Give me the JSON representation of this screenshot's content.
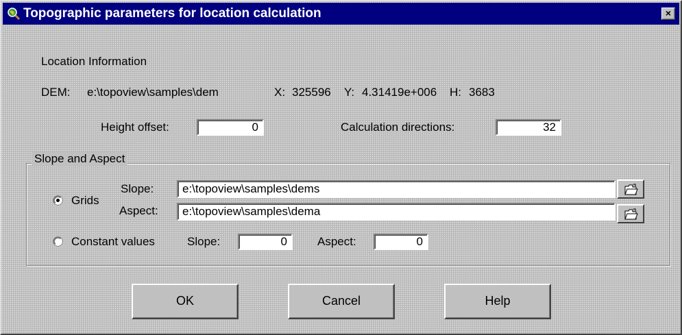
{
  "window": {
    "title": "Topographic parameters for location calculation",
    "close_label": "×"
  },
  "location": {
    "section_label": "Location Information",
    "dem_label": "DEM:",
    "dem_value": "e:\\topoview\\samples\\dem",
    "x_label": "X:",
    "x_value": "325596",
    "y_label": "Y:",
    "y_value": "4.31419e+006",
    "h_label": "H:",
    "h_value": "3683"
  },
  "height_offset": {
    "label": "Height offset:",
    "value": "0"
  },
  "calc_directions": {
    "label": "Calculation directions:",
    "value": "32"
  },
  "slope_aspect": {
    "group_label": "Slope and Aspect",
    "grids": {
      "label": "Grids",
      "selected": true,
      "slope_label": "Slope:",
      "slope_value": "e:\\topoview\\samples\\dems",
      "aspect_label": "Aspect:",
      "aspect_value": "e:\\topoview\\samples\\dema"
    },
    "constant": {
      "label": "Constant values",
      "selected": false,
      "slope_label": "Slope:",
      "slope_value": "0",
      "aspect_label": "Aspect:",
      "aspect_value": "0"
    }
  },
  "buttons": {
    "ok": "OK",
    "cancel": "Cancel",
    "help": "Help"
  },
  "icons": {
    "title": "magnifier-globe-icon",
    "browse": "open-folder-icon"
  }
}
